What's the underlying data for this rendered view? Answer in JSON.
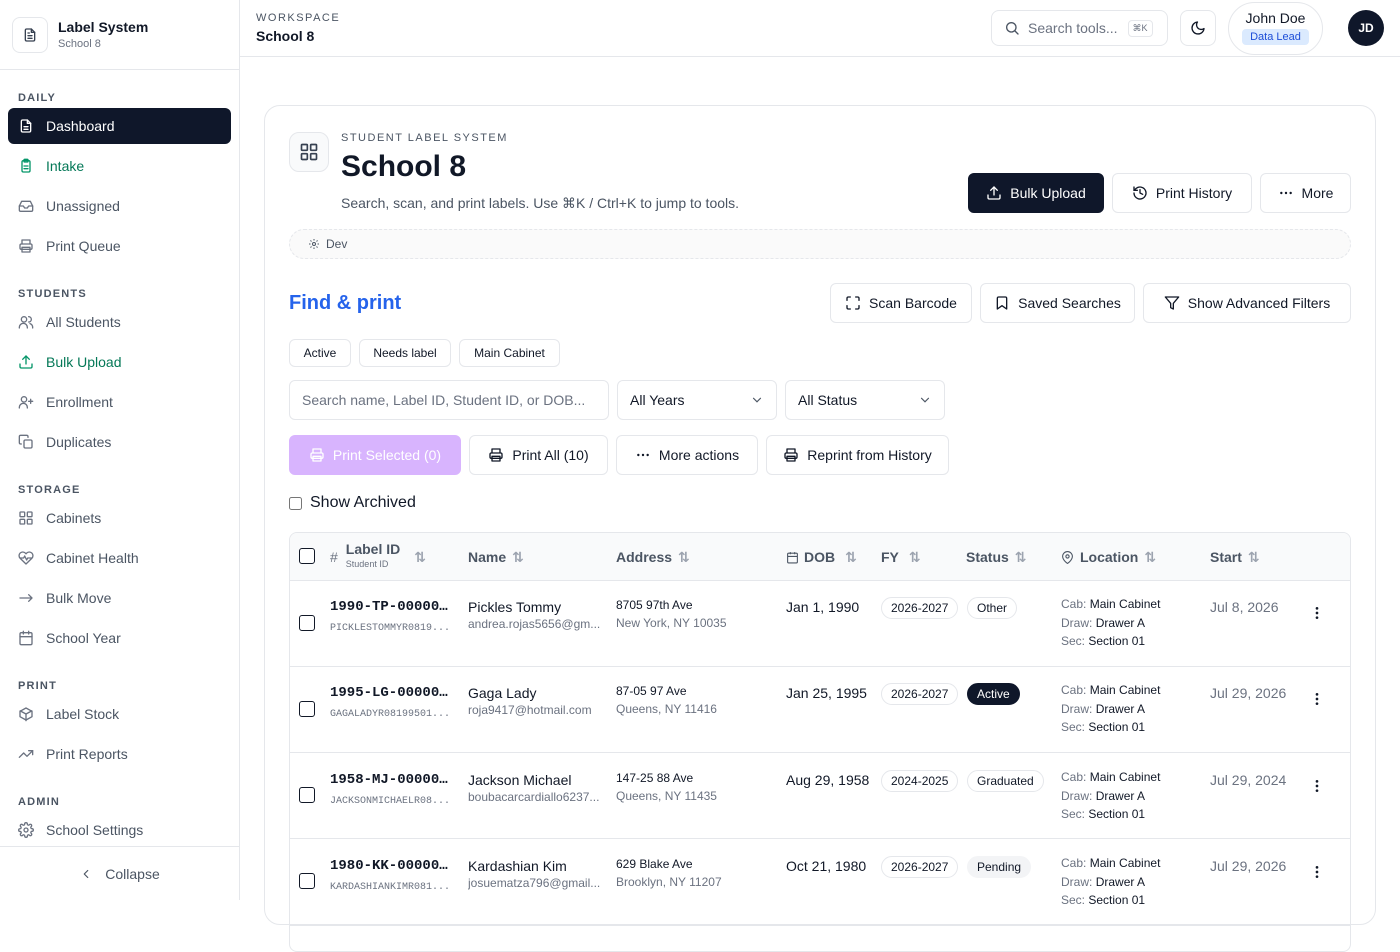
{
  "brand": {
    "title": "Label System",
    "subtitle": "School 8"
  },
  "sidebar": {
    "sections": [
      {
        "title": "DAILY",
        "items": [
          {
            "label": "Dashboard",
            "icon": "document-icon",
            "state": "active"
          },
          {
            "label": "Intake",
            "icon": "clipboard-icon",
            "state": "highlighted"
          },
          {
            "label": "Unassigned",
            "icon": "inbox-icon"
          },
          {
            "label": "Print Queue",
            "icon": "printer-icon"
          }
        ]
      },
      {
        "title": "STUDENTS",
        "items": [
          {
            "label": "All Students",
            "icon": "users-icon"
          },
          {
            "label": "Bulk Upload",
            "icon": "upload-icon",
            "state": "highlighted"
          },
          {
            "label": "Enrollment",
            "icon": "user-plus-icon"
          },
          {
            "label": "Duplicates",
            "icon": "copy-icon"
          }
        ]
      },
      {
        "title": "STORAGE",
        "items": [
          {
            "label": "Cabinets",
            "icon": "grid-icon"
          },
          {
            "label": "Cabinet Health",
            "icon": "heart-pulse-icon"
          },
          {
            "label": "Bulk Move",
            "icon": "arrow-right-icon"
          },
          {
            "label": "School Year",
            "icon": "calendar-icon"
          }
        ]
      },
      {
        "title": "PRINT",
        "items": [
          {
            "label": "Label Stock",
            "icon": "package-icon"
          },
          {
            "label": "Print Reports",
            "icon": "trend-icon"
          }
        ]
      },
      {
        "title": "ADMIN",
        "items": [
          {
            "label": "School Settings",
            "icon": "gear-icon"
          }
        ]
      }
    ],
    "collapse_label": "Collapse"
  },
  "topbar": {
    "workspace_label": "WORKSPACE",
    "workspace_value": "School 8",
    "search_placeholder": "Search tools...",
    "search_shortcut": "⌘K",
    "user_name": "John Doe",
    "user_role": "Data Lead",
    "avatar_initials": "JD"
  },
  "header": {
    "eyebrow": "STUDENT LABEL SYSTEM",
    "title": "School 8",
    "subtitle": "Search, scan, and print labels. Use ⌘K / Ctrl+K to jump to tools.",
    "bulk_upload": "Bulk Upload",
    "print_history": "Print History",
    "more": "More",
    "env": "Dev"
  },
  "find": {
    "title": "Find & print",
    "scan_barcode": "Scan Barcode",
    "saved_searches": "Saved Searches",
    "advanced_filters": "Show Advanced Filters",
    "chips": [
      "Active",
      "Needs label",
      "Main Cabinet"
    ],
    "search_placeholder": "Search name, Label ID, Student ID, or DOB...",
    "years_select": "All Years",
    "status_select": "All Status",
    "print_selected": "Print Selected (0)",
    "print_all": "Print All (10)",
    "more_actions": "More actions",
    "reprint": "Reprint from History",
    "show_archived": "Show Archived"
  },
  "table": {
    "headers": {
      "label_id": "Label ID",
      "label_id_sub": "Student ID",
      "name": "Name",
      "address": "Address",
      "dob": "DOB",
      "fy": "FY",
      "status": "Status",
      "location": "Location",
      "start": "Start"
    },
    "location_labels": {
      "cab": "Cab:",
      "draw": "Draw:",
      "sec": "Sec:"
    },
    "rows": [
      {
        "label_id": "1990-TP-00000...",
        "student_id": "PICKLESTOMMYR0819...",
        "name": "Pickles Tommy",
        "email": "andrea.rojas5656@gm...",
        "addr1": "8705 97th Ave",
        "addr2": "New York, NY 10035",
        "dob": "Jan 1, 1990",
        "fy": "2026-2027",
        "status": "Other",
        "cab": "Main Cabinet",
        "draw": "Drawer A",
        "sec": "Section 01",
        "start": "Jul 8, 2026"
      },
      {
        "label_id": "1995-LG-00000...",
        "student_id": "GAGALADYR08199501...",
        "name": "Gaga Lady",
        "email": "roja9417@hotmail.com",
        "addr1": "87-05 97 Ave",
        "addr2": "Queens, NY 11416",
        "dob": "Jan 25, 1995",
        "fy": "2026-2027",
        "status": "Active",
        "cab": "Main Cabinet",
        "draw": "Drawer A",
        "sec": "Section 01",
        "start": "Jul 29, 2026"
      },
      {
        "label_id": "1958-MJ-00000...",
        "student_id": "JACKSONMICHAELR08...",
        "name": "Jackson Michael",
        "email": "boubacarcardiallo6237...",
        "addr1": "147-25 88 Ave",
        "addr2": "Queens, NY 11435",
        "dob": "Aug 29, 1958",
        "fy": "2024-2025",
        "status": "Graduated",
        "cab": "Main Cabinet",
        "draw": "Drawer A",
        "sec": "Section 01",
        "start": "Jul 29, 2024"
      },
      {
        "label_id": "1980-KK-00000...",
        "student_id": "KARDASHIANKIMR081...",
        "name": "Kardashian Kim",
        "email": "josuematza796@gmail...",
        "addr1": "629 Blake Ave",
        "addr2": "Brooklyn, NY 11207",
        "dob": "Oct 21, 1980",
        "fy": "2026-2027",
        "status": "Pending",
        "cab": "Main Cabinet",
        "draw": "Drawer A",
        "sec": "Section 01",
        "start": "Jul 29, 2026"
      }
    ]
  }
}
